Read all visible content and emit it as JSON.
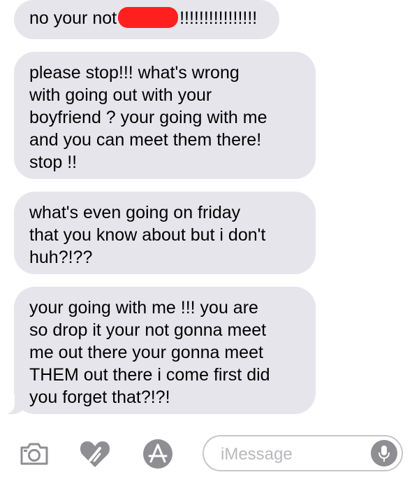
{
  "messages": [
    {
      "text_before": "no your not",
      "text_after": "!!!!!!!!!!!!!!!!",
      "redacted": true
    },
    {
      "text": "please stop!!! what's wrong\nwith going out with your\nboyfriend ? your going with me\nand you can meet them there!\nstop !!"
    },
    {
      "text": "what's even going on friday\nthat you know about but i don't\nhuh?!??"
    },
    {
      "text": "your going with me !!! you are\nso drop it your not gonna meet\nme out there your gonna meet\nTHEM out there i come first did\nyou forget that?!?!"
    }
  ],
  "compose": {
    "placeholder": "iMessage"
  },
  "icons": {
    "camera": "camera-icon",
    "digital_touch": "digital-touch-heart-icon",
    "app_store": "app-store-icon",
    "mic": "microphone-icon"
  },
  "colors": {
    "bubble": "#e6e5eb",
    "redaction": "#ff1f1f",
    "icon_gray": "#8e8e93",
    "placeholder": "#b9b9bd"
  }
}
